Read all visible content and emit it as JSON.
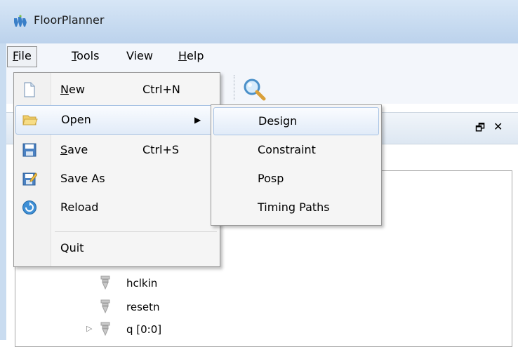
{
  "window": {
    "title": "FloorPlanner"
  },
  "menubar": {
    "items": [
      {
        "label": "File",
        "mnemonic": "F"
      },
      {
        "label": "Tools",
        "mnemonic": "T"
      },
      {
        "label": "View",
        "mnemonic": ""
      },
      {
        "label": "Help",
        "mnemonic": "H"
      }
    ]
  },
  "file_menu": {
    "items": [
      {
        "label": "New",
        "shortcut": "Ctrl+N",
        "icon": "new-file-icon"
      },
      {
        "label": "Open",
        "shortcut": "",
        "icon": "open-folder-icon",
        "has_submenu": true
      },
      {
        "label": "Save",
        "shortcut": "Ctrl+S",
        "icon": "save-icon"
      },
      {
        "label": "Save As",
        "shortcut": "",
        "icon": "save-as-icon"
      },
      {
        "label": "Reload",
        "shortcut": "",
        "icon": "reload-icon"
      },
      {
        "label": "Quit",
        "shortcut": "",
        "icon": ""
      }
    ]
  },
  "open_submenu": {
    "items": [
      {
        "label": "Design"
      },
      {
        "label": "Constraint"
      },
      {
        "label": "Posp"
      },
      {
        "label": "Timing Paths"
      }
    ]
  },
  "panel": {
    "restore_glyph": "🗗",
    "close_glyph": "✕"
  },
  "tree": {
    "items": [
      {
        "label": "hclkin"
      },
      {
        "label": "resetn"
      },
      {
        "label": "q [0:0]"
      }
    ]
  },
  "colors": {
    "titlebar": "#c6daf0",
    "highlight_border": "#a8c3e4",
    "menu_bg": "#f5f5f5"
  }
}
